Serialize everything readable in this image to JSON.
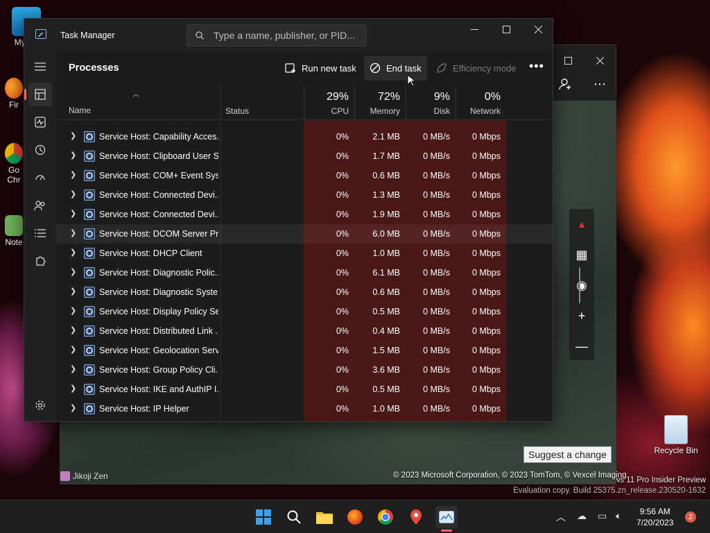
{
  "desktop": {
    "icons": [
      {
        "label": "My Co"
      },
      {
        "label": "Fir"
      },
      {
        "label": "Go\nChr"
      },
      {
        "label": "Note"
      }
    ],
    "recycle_bin": "Recycle Bin",
    "watermark_line1": "ws 11 Pro Insider Preview",
    "watermark_line2": "Evaluation copy. Build 25375.zn_release.230520-1632"
  },
  "maps_window": {
    "suggest_label": "Suggest a change",
    "copyright": "© 2023 Microsoft Corporation, © 2023 TomTom, © Vexcel Imaging",
    "watermark": "Jikoji Zen"
  },
  "task_manager": {
    "title": "Task Manager",
    "search_placeholder": "Type a name, publisher, or PID...",
    "page_title": "Processes",
    "commands": {
      "run_new_task": "Run new task",
      "end_task": "End task",
      "efficiency_mode": "Efficiency mode",
      "more": "•••"
    },
    "columns": {
      "name": "Name",
      "status": "Status",
      "cpu": {
        "pct": "29%",
        "label": "CPU"
      },
      "memory": {
        "pct": "72%",
        "label": "Memory"
      },
      "disk": {
        "pct": "9%",
        "label": "Disk"
      },
      "network": {
        "pct": "0%",
        "label": "Network"
      }
    },
    "rows": [
      {
        "name": "Service Host: Capability Acces...",
        "cpu": "0%",
        "memory": "2.1 MB",
        "disk": "0 MB/s",
        "network": "0 Mbps"
      },
      {
        "name": "Service Host: Clipboard User S...",
        "cpu": "0%",
        "memory": "1.7 MB",
        "disk": "0 MB/s",
        "network": "0 Mbps"
      },
      {
        "name": "Service Host: COM+ Event Sys...",
        "cpu": "0%",
        "memory": "0.6 MB",
        "disk": "0 MB/s",
        "network": "0 Mbps"
      },
      {
        "name": "Service Host: Connected Devi...",
        "cpu": "0%",
        "memory": "1.3 MB",
        "disk": "0 MB/s",
        "network": "0 Mbps"
      },
      {
        "name": "Service Host: Connected Devi...",
        "cpu": "0%",
        "memory": "1.9 MB",
        "disk": "0 MB/s",
        "network": "0 Mbps"
      },
      {
        "name": "Service Host: DCOM Server Pr...",
        "cpu": "0%",
        "memory": "6.0 MB",
        "disk": "0 MB/s",
        "network": "0 Mbps"
      },
      {
        "name": "Service Host: DHCP Client",
        "cpu": "0%",
        "memory": "1.0 MB",
        "disk": "0 MB/s",
        "network": "0 Mbps"
      },
      {
        "name": "Service Host: Diagnostic Polic...",
        "cpu": "0%",
        "memory": "6.1 MB",
        "disk": "0 MB/s",
        "network": "0 Mbps"
      },
      {
        "name": "Service Host: Diagnostic Syste...",
        "cpu": "0%",
        "memory": "0.6 MB",
        "disk": "0 MB/s",
        "network": "0 Mbps"
      },
      {
        "name": "Service Host: Display Policy Se...",
        "cpu": "0%",
        "memory": "0.5 MB",
        "disk": "0 MB/s",
        "network": "0 Mbps"
      },
      {
        "name": "Service Host: Distributed Link ...",
        "cpu": "0%",
        "memory": "0.4 MB",
        "disk": "0 MB/s",
        "network": "0 Mbps"
      },
      {
        "name": "Service Host: Geolocation Serv...",
        "cpu": "0%",
        "memory": "1.5 MB",
        "disk": "0 MB/s",
        "network": "0 Mbps"
      },
      {
        "name": "Service Host: Group Policy Cli...",
        "cpu": "0%",
        "memory": "3.6 MB",
        "disk": "0 MB/s",
        "network": "0 Mbps"
      },
      {
        "name": "Service Host: IKE and AuthIP I...",
        "cpu": "0%",
        "memory": "0.5 MB",
        "disk": "0 MB/s",
        "network": "0 Mbps"
      },
      {
        "name": "Service Host: IP Helper",
        "cpu": "0%",
        "memory": "1.0 MB",
        "disk": "0 MB/s",
        "network": "0 Mbps"
      }
    ],
    "highlighted_row": 5
  },
  "taskbar": {
    "time": "9:56 AM",
    "date": "7/20/2023",
    "notifications": "2"
  },
  "colors": {
    "accent": "#ff5b5b",
    "heat": "#4a1717",
    "window_bg": "#1c1c1c"
  }
}
